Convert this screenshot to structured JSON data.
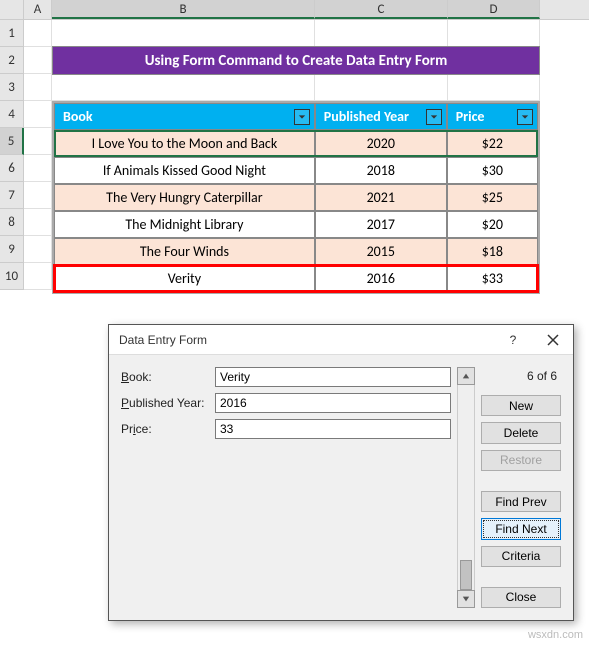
{
  "columns": [
    "A",
    "B",
    "C",
    "D"
  ],
  "title": "Using Form Command to Create Data Entry Form",
  "table": {
    "headers": {
      "book": "Book",
      "year": "Published Year",
      "price": "Price"
    },
    "rows": [
      {
        "book": "I Love You to the Moon and Back",
        "year": "2020",
        "price": "$22"
      },
      {
        "book": "If Animals Kissed Good Night",
        "year": "2018",
        "price": "$30"
      },
      {
        "book": "The Very Hungry Caterpillar",
        "year": "2021",
        "price": "$25"
      },
      {
        "book": "The Midnight Library",
        "year": "2017",
        "price": "$20"
      },
      {
        "book": "The Four Winds",
        "year": "2015",
        "price": "$18"
      },
      {
        "book": "Verity",
        "year": "2016",
        "price": "$33"
      }
    ]
  },
  "dialog": {
    "title": "Data Entry Form",
    "help": "?",
    "labels": {
      "book": "Book:",
      "year": "Published Year:",
      "price": "Price:"
    },
    "underline": {
      "book": "B",
      "year": "P",
      "price": "i"
    },
    "values": {
      "book": "Verity",
      "year": "2016",
      "price": "33"
    },
    "counter": "6 of 6",
    "buttons": {
      "new": "New",
      "delete": "Delete",
      "restore": "Restore",
      "findprev": "Find Prev",
      "findnext": "Find Next",
      "criteria": "Criteria",
      "close": "Close"
    }
  },
  "watermark": "wsxdn.com"
}
